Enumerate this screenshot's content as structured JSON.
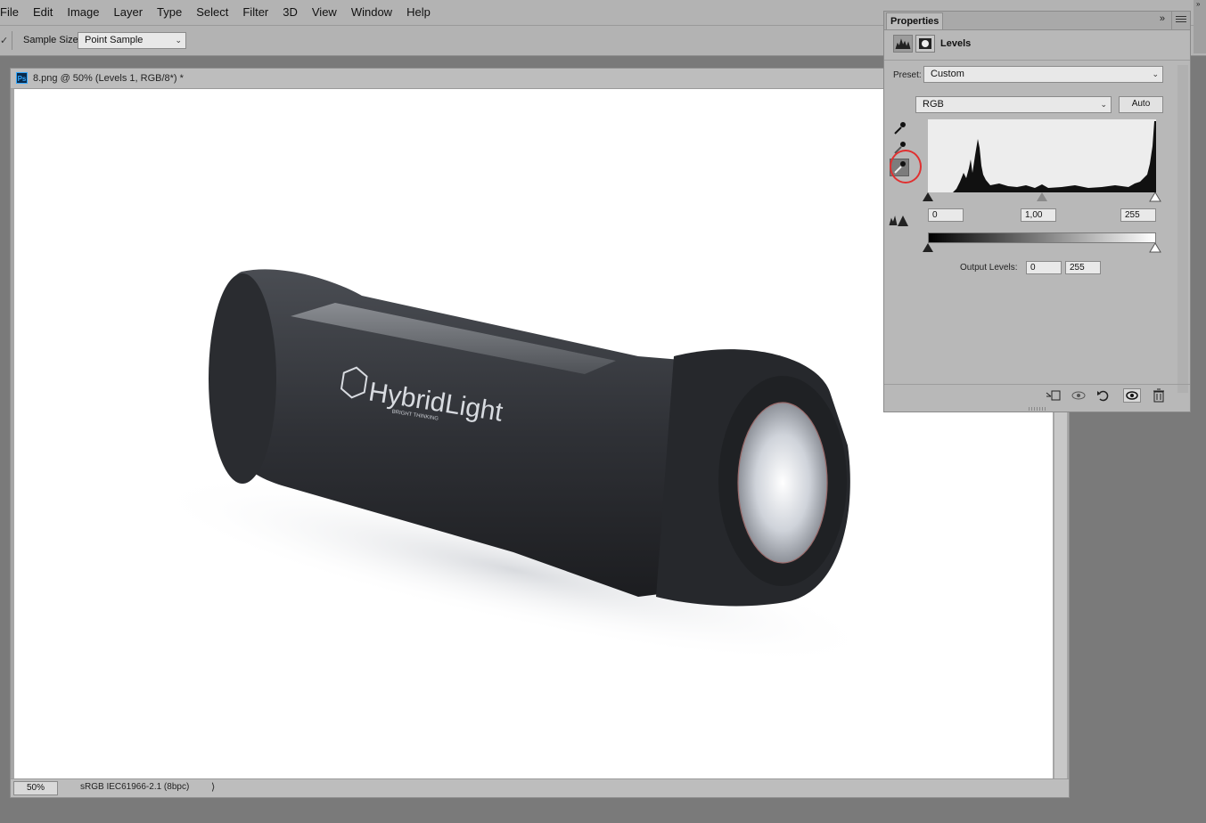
{
  "menu": [
    "File",
    "Edit",
    "Image",
    "Layer",
    "Type",
    "Select",
    "Filter",
    "3D",
    "View",
    "Window",
    "Help"
  ],
  "options_bar": {
    "sample_size_label": "Sample Size:",
    "sample_size_value": "Point Sample"
  },
  "document": {
    "badge": "Ps",
    "title": "8.png @ 50% (Levels 1, RGB/8*) *",
    "zoom": "50%",
    "profile": "sRGB IEC61966-2.1 (8bpc)",
    "brand_logo_text": "HybridLight",
    "brand_tagline": "BRIGHT THINKING"
  },
  "properties": {
    "tab_label": "Properties",
    "adjustment_name": "Levels",
    "preset_label": "Preset:",
    "preset_value": "Custom",
    "channel_value": "RGB",
    "auto_label": "Auto",
    "input_black": "0",
    "input_gamma": "1,00",
    "input_white": "255",
    "output_label": "Output Levels:",
    "output_black": "0",
    "output_white": "255",
    "active_eyedropper": "white-point",
    "icons": {
      "eyedroppers": [
        "black-point-eyedropper-icon",
        "gray-point-eyedropper-icon",
        "white-point-eyedropper-icon"
      ],
      "footer": [
        "clip-to-layer-icon",
        "view-previous-state-icon",
        "reset-icon",
        "visibility-icon",
        "trash-icon"
      ]
    }
  },
  "colors": {
    "workspace": "#7a7a7a",
    "chrome": "#b3b3b3",
    "highlight_ring": "#e03030"
  }
}
